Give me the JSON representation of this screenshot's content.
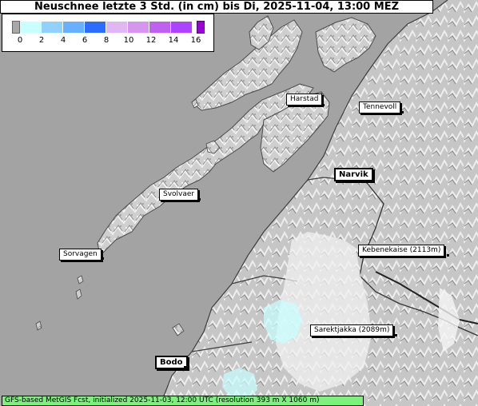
{
  "title": "Neuschnee letzte 3 Std. (in cm) bis Di, 2025-11-04, 13:00 MEZ",
  "legend": {
    "ticks": [
      "0",
      "2",
      "4",
      "6",
      "8",
      "10",
      "12",
      "14",
      "16"
    ],
    "colors": [
      "#c8ffff",
      "#8fd2ff",
      "#66b0ff",
      "#2c6cff",
      "#e0b7f2",
      "#d696f0",
      "#c060f0",
      "#ad43ff"
    ],
    "below_min_color": "#a8a8a8",
    "above_max_color": "#9b00d8"
  },
  "places": [
    {
      "name": "Harstad",
      "bold": false
    },
    {
      "name": "Tennevoll",
      "bold": false
    },
    {
      "name": "Narvik",
      "bold": true
    },
    {
      "name": "Svolvaer",
      "bold": false
    },
    {
      "name": "Sorvagen",
      "bold": false
    },
    {
      "name": "Kebenekaise (2113m)",
      "bold": false
    },
    {
      "name": "Sarektjakka (2089m)",
      "bold": false
    },
    {
      "name": "Bodo",
      "bold": true
    }
  ],
  "footer": "GFS-based MetGIS Fcst, initialized 2025-11-03, 12:00 UTC  (resolution 393 m X 1060 m)",
  "colors": {
    "sea": "#a3a3a3",
    "land_light": "#d9d9d9",
    "land_dark": "#8c8c8c",
    "snow_light": "#c8ffff",
    "footer_bg": "#7cf27c"
  }
}
